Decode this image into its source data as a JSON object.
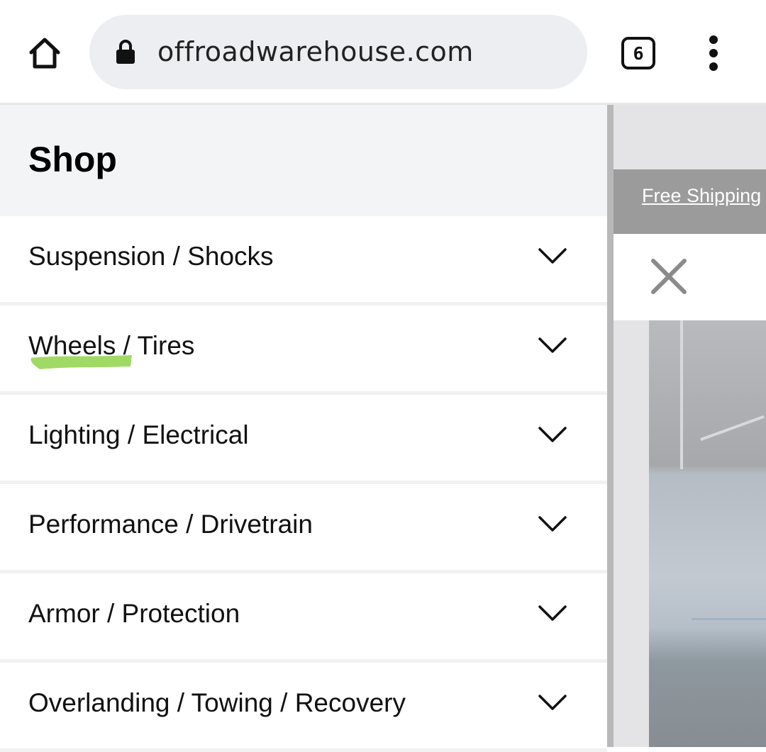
{
  "browser": {
    "url": "offroadwarehouse.com",
    "tab_count": "6"
  },
  "page": {
    "promo_text": "Free Shipping"
  },
  "drawer": {
    "title": "Shop",
    "items": [
      {
        "label": "Suspension / Shocks"
      },
      {
        "label": "Wheels / Tires"
      },
      {
        "label": "Lighting / Electrical"
      },
      {
        "label": "Performance / Drivetrain"
      },
      {
        "label": "Armor / Protection"
      },
      {
        "label": "Overlanding / Towing / Recovery"
      }
    ]
  },
  "colors": {
    "highlight_mark": "#8fd44a",
    "drawer_header_bg": "#f3f4f6",
    "omnibox_bg": "#eceef1",
    "promo_bar_bg": "#9b9b9b"
  },
  "icons": [
    "home-icon",
    "lock-icon",
    "tab-switcher-icon",
    "more-options-icon",
    "close-icon",
    "chevron-down-icon"
  ]
}
